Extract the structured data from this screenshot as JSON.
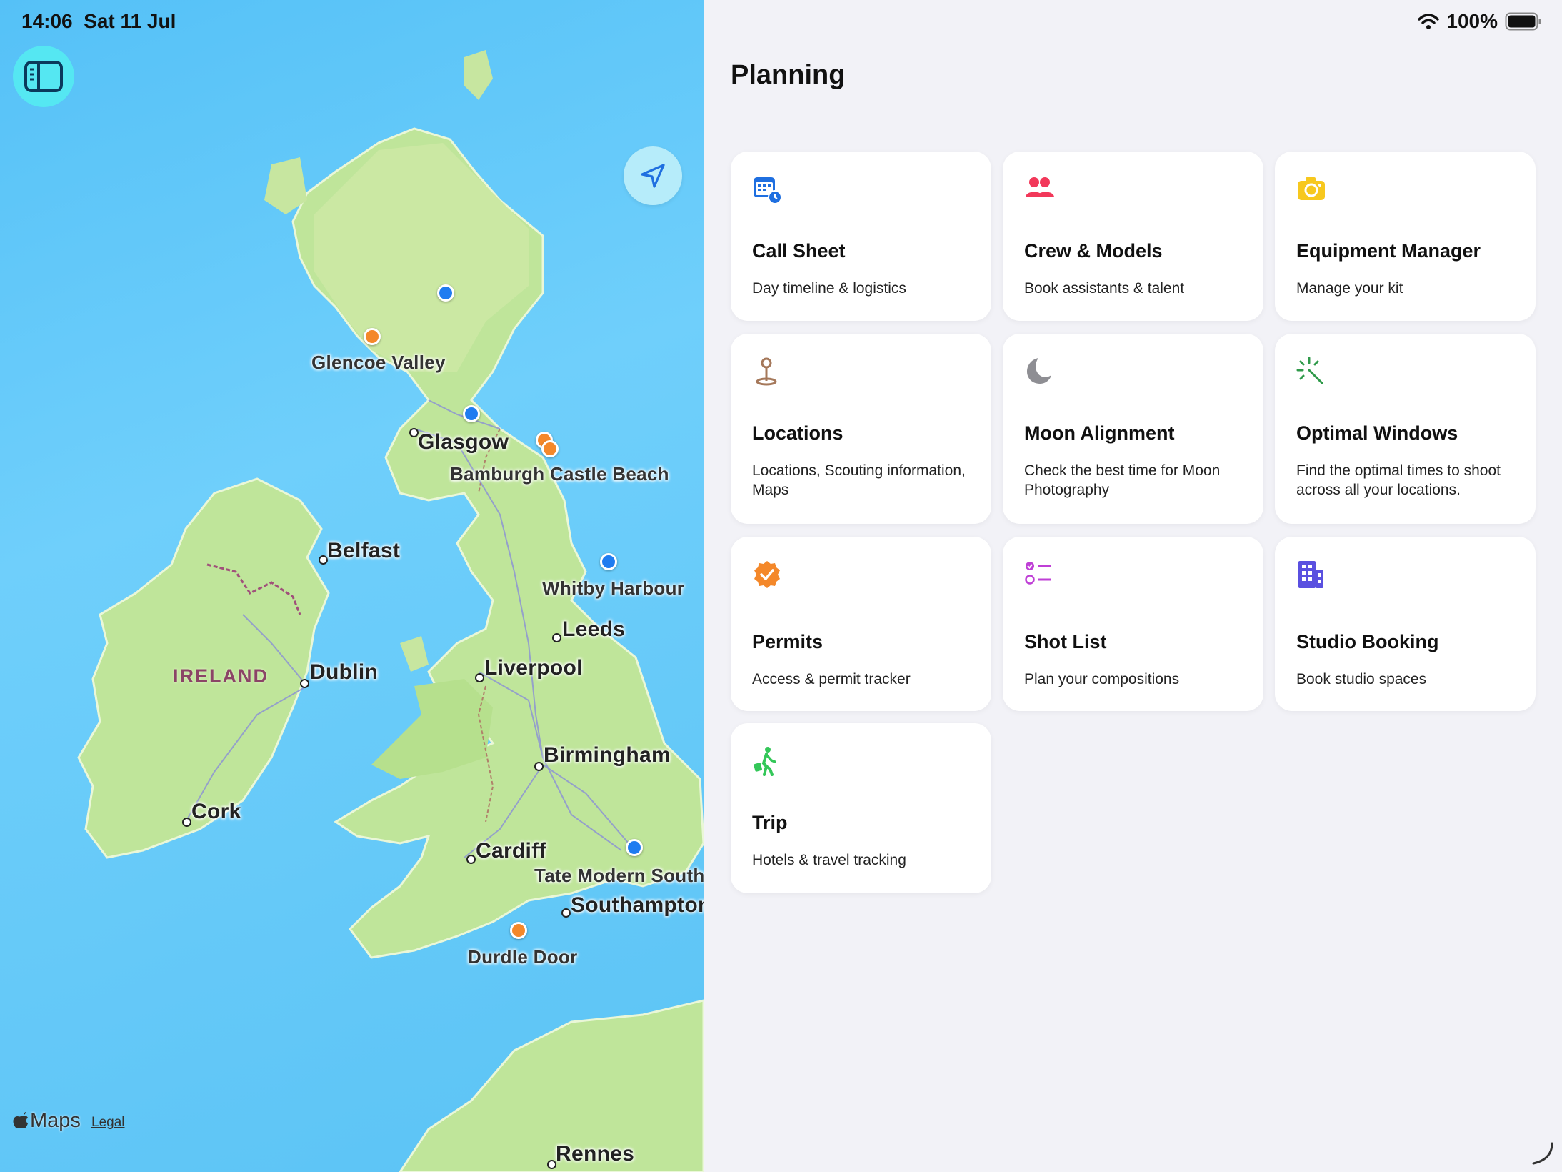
{
  "status": {
    "time": "14:06",
    "date": "Sat 11 Jul",
    "battery": "100%"
  },
  "map": {
    "places": {
      "glencoe": "Glencoe Valley",
      "glasgow": "Glasgow",
      "bamburgh": "Bamburgh Castle Beach",
      "belfast": "Belfast",
      "whitby": "Whitby Harbour",
      "leeds": "Leeds",
      "ireland": "IRELAND",
      "dublin": "Dublin",
      "liverpool": "Liverpool",
      "birmingham": "Birmingham",
      "cork": "Cork",
      "cardiff": "Cardiff",
      "tate": "Tate Modern South B",
      "southampton": "Southampton",
      "durdle": "Durdle Door",
      "rennes": "Rennes"
    },
    "pin_colors": {
      "blue": "#1f7cf0",
      "orange": "#f4882a"
    },
    "maps_logo": "Maps",
    "legal": "Legal",
    "sidebar_icon": "sidebar-toggle-icon",
    "locate_icon": "location-arrow-icon"
  },
  "panel": {
    "title": "Planning",
    "cards": [
      {
        "title": "Call Sheet",
        "subtitle": "Day timeline & logistics",
        "icon": "calendar-clock-icon",
        "color": "#1f6fe0"
      },
      {
        "title": "Crew & Models",
        "subtitle": "Book assistants & talent",
        "icon": "people-icon",
        "color": "#f2385a"
      },
      {
        "title": "Equipment Manager",
        "subtitle": "Manage your kit",
        "icon": "camera-icon",
        "color": "#f7c81e"
      },
      {
        "title": "Locations",
        "subtitle": "Locations, Scouting information, Maps",
        "icon": "map-pin-icon",
        "color": "#a5785a"
      },
      {
        "title": "Moon Alignment",
        "subtitle": "Check the best time for Moon Photography",
        "icon": "moon-icon",
        "color": "#8e8e93"
      },
      {
        "title": "Optimal Windows",
        "subtitle": "Find the optimal times to shoot across all your locations.",
        "icon": "sparkle-wand-icon",
        "color": "#2f9a4a"
      },
      {
        "title": "Permits",
        "subtitle": "Access & permit tracker",
        "icon": "checkmark-seal-icon",
        "color": "#f4882a"
      },
      {
        "title": "Shot List",
        "subtitle": "Plan your compositions",
        "icon": "checklist-icon",
        "color": "#bf3fd6"
      },
      {
        "title": "Studio Booking",
        "subtitle": "Book studio spaces",
        "icon": "building-icon",
        "color": "#5a50e0"
      },
      {
        "title": "Trip",
        "subtitle": "Hotels & travel tracking",
        "icon": "traveler-icon",
        "color": "#34c759"
      }
    ]
  }
}
